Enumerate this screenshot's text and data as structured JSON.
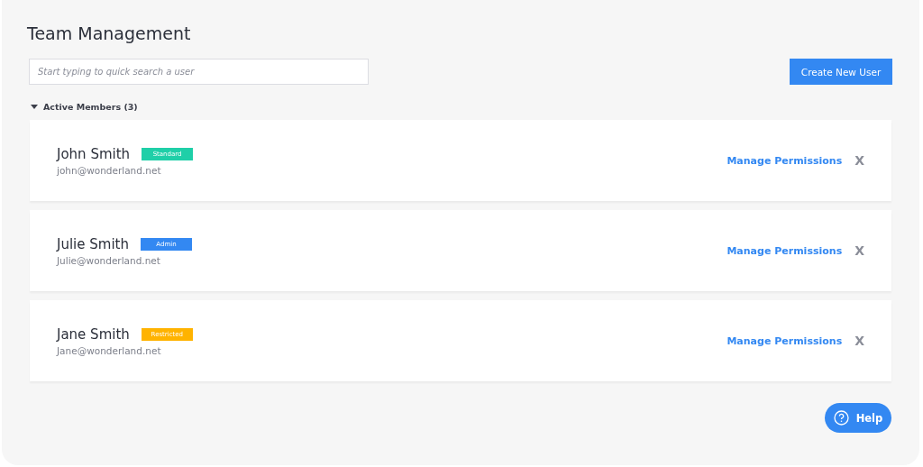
{
  "title": "Team Management",
  "search": {
    "placeholder": "Start typing to quick search a user"
  },
  "create_button": "Create New User",
  "section": {
    "label": "Active Members (3)",
    "expanded": true
  },
  "members": [
    {
      "name": "John Smith",
      "role": "Standard",
      "color": "#1fcfa8",
      "email": "john@wonderland.net",
      "action": "Manage Permissions",
      "remove": "X"
    },
    {
      "name": "Julie Smith",
      "role": "Admin",
      "color": "#3388f2",
      "email": "Julie@wonderland.net",
      "action": "Manage Permissions",
      "remove": "X"
    },
    {
      "name": "Jane Smith",
      "role": "Restricted",
      "color": "#ffb300",
      "email": "Jane@wonderland.net",
      "action": "Manage Permissions",
      "remove": "X"
    }
  ],
  "help_button": "Help"
}
